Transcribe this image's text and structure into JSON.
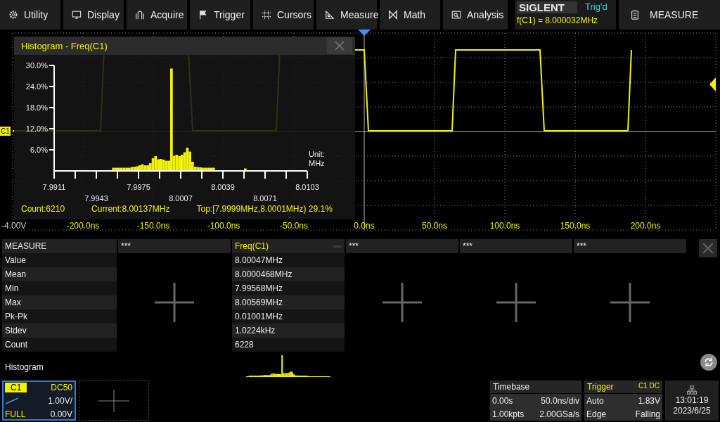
{
  "menu": [
    {
      "label": "Utility"
    },
    {
      "label": "Display"
    },
    {
      "label": "Acquire"
    },
    {
      "label": "Trigger"
    },
    {
      "label": "Cursors"
    },
    {
      "label": "Measure"
    },
    {
      "label": "Math"
    },
    {
      "label": "Analysis"
    }
  ],
  "status": {
    "logo": "SIGLENT",
    "trigger_state": "Trig'd",
    "frequency": "f(C1) = 8.000032MHz"
  },
  "menu_button": {
    "label": "MEASURE"
  },
  "scope": {
    "channel_marker": "C1",
    "voltage_label": "-4.00V",
    "time_labels": [
      "-200.0ns",
      "-150.0ns",
      "-100.0ns",
      "-50.0ns",
      "0.0ns",
      "50.0ns",
      "100.0ns",
      "150.0ns",
      "200.0ns"
    ]
  },
  "histogram_window": {
    "title": "Histogram - Freq(C1)",
    "chart_data": {
      "type": "bar",
      "xlabel": "Unit: MHz",
      "x": [
        7.9955,
        7.9957,
        7.9959,
        7.9961,
        7.9963,
        7.9965,
        7.9967,
        7.9969,
        7.9971,
        7.9973,
        7.9975,
        7.9977,
        7.9979,
        7.9981,
        7.9983,
        7.9985,
        7.9987,
        7.9989,
        7.9991,
        7.9993,
        7.9995,
        7.9997,
        7.9999,
        8.0001,
        8.0003,
        8.0005,
        8.0007,
        8.0009,
        8.0011,
        8.0013,
        8.0015,
        8.0017,
        8.0019,
        8.0021,
        8.0023,
        8.0025,
        8.0027,
        8.0029,
        8.0031,
        8.0055
      ],
      "values": [
        0.9,
        0.9,
        0.9,
        0.9,
        0.9,
        0.9,
        0.9,
        1.1,
        1.2,
        1.3,
        1.6,
        1.9,
        1.6,
        1.6,
        2.2,
        3.6,
        4.2,
        3.3,
        3.4,
        3.2,
        2.9,
        2.9,
        29.1,
        4.3,
        4.6,
        4.2,
        4.6,
        5.3,
        6.6,
        5.5,
        2.6,
        1.2,
        1.1,
        1.0,
        0.9,
        0.9,
        0.9,
        0.9,
        0.9,
        0.7
      ],
      "xlim": [
        7.9911,
        8.0103
      ],
      "ylim": [
        0,
        30
      ],
      "xticks": [
        7.9911,
        7.9975,
        8.0039,
        8.0103
      ],
      "yticks": [
        {
          "value": 6,
          "label": "6.0%"
        },
        {
          "value": 12,
          "label": "12.0%"
        },
        {
          "value": 18,
          "label": "18.0%"
        },
        {
          "value": 24,
          "label": "24.0%"
        },
        {
          "value": 30,
          "label": "30.0%"
        }
      ]
    },
    "lower_tick_labels": [
      "7.9943",
      "8.0007",
      "8.0071"
    ],
    "stats": [
      "Count:6210",
      "Current:8.00137MHz",
      "Top:[7.9999MHz,8.0001MHz) 29.1%"
    ]
  },
  "measure": {
    "header": "MEASURE",
    "rows": [
      "Value",
      "Mean",
      "Min",
      "Max",
      "Pk-Pk",
      "Stdev",
      "Count"
    ],
    "histogram_label": "Histogram",
    "columns": [
      {
        "kind": "empty",
        "title": "***"
      },
      {
        "kind": "measurement",
        "title": "Freq(C1)",
        "values": [
          "8.00047MHz",
          "8.0000468MHz",
          "7.99568MHz",
          "8.00569MHz",
          "0.01001MHz",
          "1.0224kHz",
          "6228"
        ]
      },
      {
        "kind": "empty",
        "title": "***"
      },
      {
        "kind": "empty",
        "title": "***"
      },
      {
        "kind": "empty",
        "title": "***"
      }
    ]
  },
  "channel": {
    "name": "C1",
    "coupling": "DC50",
    "scale": "1.00V/",
    "bandwidth": "FULL",
    "offset": "0.00V"
  },
  "timebase": {
    "title": "Timebase",
    "delay": "0.00s",
    "scale": "50.0ns/div",
    "memory": "1.00kpts",
    "sample_rate": "2.00GSa/s"
  },
  "trigger": {
    "title": "Trigger",
    "source": "C1 DC",
    "mode": "Auto",
    "level": "1.83V",
    "type": "Edge",
    "slope": "Falling"
  },
  "clock": {
    "time": "13:01:19",
    "date": "2023/6/25"
  }
}
